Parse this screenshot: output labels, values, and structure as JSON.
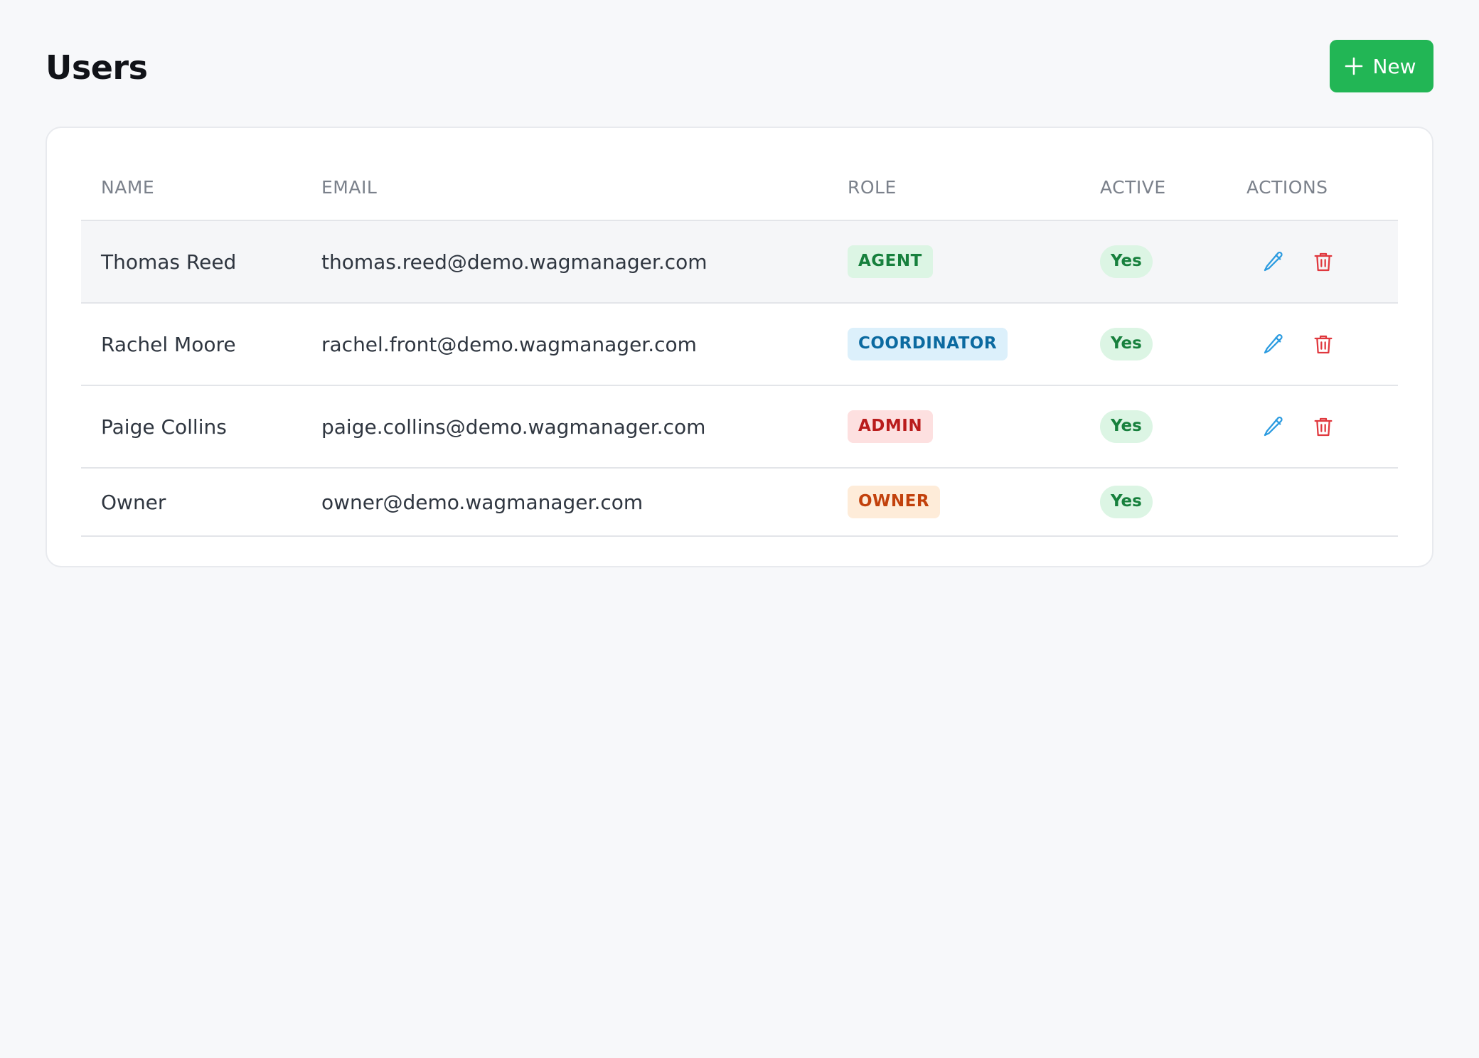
{
  "page": {
    "title": "Users",
    "new_button_label": "New",
    "new_button_icon": "plus-icon"
  },
  "table": {
    "columns": [
      "NAME",
      "EMAIL",
      "ROLE",
      "ACTIVE",
      "ACTIONS"
    ],
    "rows": [
      {
        "name": "Thomas Reed",
        "email": "thomas.reed@demo.wagmanager.com",
        "role": "AGENT",
        "role_bg": "#dcf5e4",
        "role_fg": "#17803d",
        "active": "Yes",
        "has_actions": true
      },
      {
        "name": "Rachel Moore",
        "email": "rachel.front@demo.wagmanager.com",
        "role": "COORDINATOR",
        "role_bg": "#dcf0fb",
        "role_fg": "#0b6aa0",
        "active": "Yes",
        "has_actions": true
      },
      {
        "name": "Paige Collins",
        "email": "paige.collins@demo.wagmanager.com",
        "role": "ADMIN",
        "role_bg": "#fde0e0",
        "role_fg": "#b91c1c",
        "active": "Yes",
        "has_actions": true
      },
      {
        "name": "Owner",
        "email": "owner@demo.wagmanager.com",
        "role": "OWNER",
        "role_bg": "#feecd9",
        "role_fg": "#c2410c",
        "active": "Yes",
        "has_actions": false
      }
    ]
  },
  "icons": {
    "edit": "pencil-icon",
    "delete": "trash-icon"
  },
  "colors": {
    "accent": "#22b655",
    "edit_icon": "#2b9be0",
    "delete_icon": "#e0383e"
  }
}
